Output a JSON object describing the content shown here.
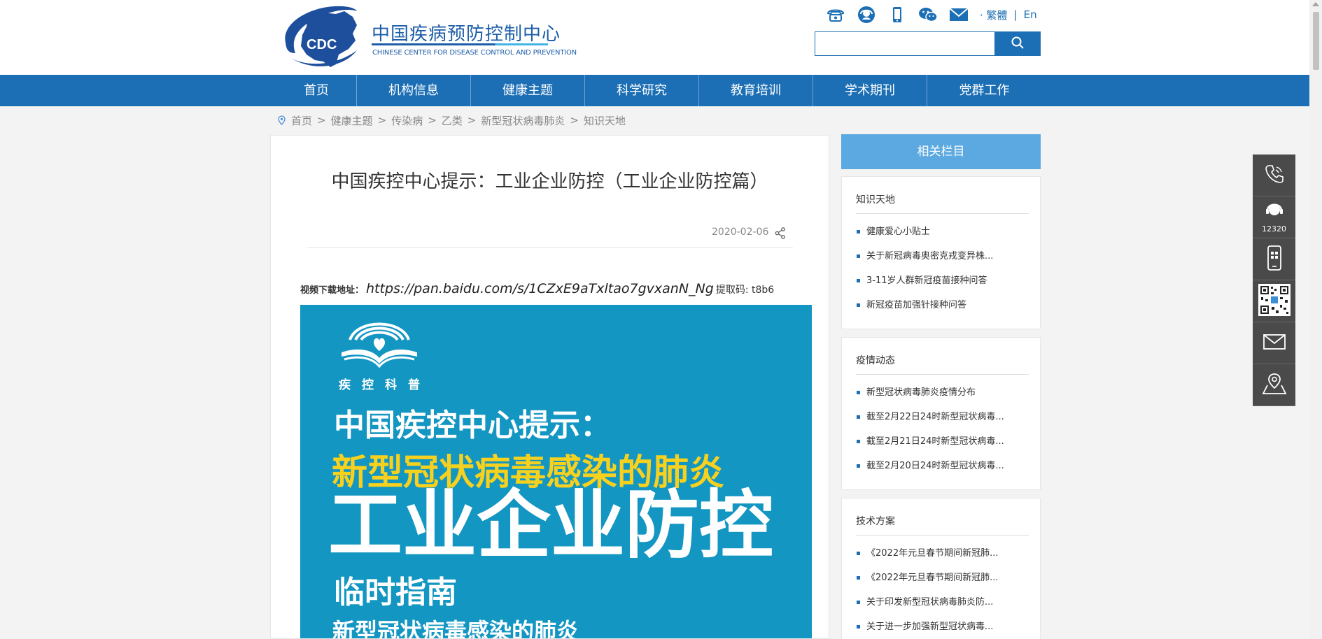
{
  "header": {
    "logo_text": "CDC",
    "site_name_cn": "中国疾病预防控制中心",
    "site_name_en": "CHINESE CENTER FOR DISEASE CONTROL AND PREVENTION",
    "top_icons": [
      "phone-icon",
      "hotline-icon",
      "mobile-icon",
      "wechat-icon",
      "mail-icon"
    ],
    "lang_traditional": "· 繁體",
    "lang_sep": "|",
    "lang_english": "En",
    "search_placeholder": ""
  },
  "nav": {
    "items": [
      {
        "label": "首页"
      },
      {
        "label": "机构信息"
      },
      {
        "label": "健康主题"
      },
      {
        "label": "科学研究"
      },
      {
        "label": "教育培训"
      },
      {
        "label": "学术期刊"
      },
      {
        "label": "党群工作"
      }
    ]
  },
  "breadcrumb": {
    "sep": ">",
    "items": [
      "首页",
      "健康主题",
      "传染病",
      "乙类",
      "新型冠状病毒肺炎",
      "知识天地"
    ]
  },
  "article": {
    "title": "中国疾控中心提示：工业企业防控（工业企业防控篇）",
    "date": "2020-02-06",
    "video_label": "视频下载地址：",
    "video_url": "https://pan.baidu.com/s/1CZxE9aTxltao7gvxanN_Ng",
    "extract_code": "提取码: t8b6",
    "poster": {
      "logo_text": "疾控科普",
      "line1": "中国疾控中心提示：",
      "line2": "新型冠状病毒感染的肺炎",
      "line3": "工业企业防控",
      "line4": "临时指南",
      "line5": "新型冠状病毒感染的肺炎"
    }
  },
  "sidebar": {
    "header": "相关栏目",
    "sections": [
      {
        "title": "知识天地",
        "items": [
          "健康爱心小贴士",
          "关于新冠病毒奥密克戎变异株...",
          "3-11岁人群新冠疫苗接种问答",
          "新冠疫苗加强针接种问答"
        ]
      },
      {
        "title": "疫情动态",
        "items": [
          "新型冠状病毒肺炎疫情分布",
          "截至2月22日24时新型冠状病毒...",
          "截至2月21日24时新型冠状病毒...",
          "截至2月20日24时新型冠状病毒..."
        ]
      },
      {
        "title": "技术方案",
        "items": [
          "《2022年元旦春节期间新冠肺...",
          "《2022年元旦春节期间新冠肺...",
          "关于印发新型冠状病毒肺炎防...",
          "关于进一步加强新型冠状病毒..."
        ]
      }
    ]
  },
  "float_bar": {
    "hotline_number": "12320",
    "items": [
      "phone-icon",
      "hotline-icon",
      "mobile-icon",
      "qrcode-icon",
      "mail-icon",
      "map-icon"
    ]
  },
  "colors": {
    "brand_blue": "#1d6fb5",
    "sidebar_header": "#5ba9e0",
    "poster_bg": "#1396c2",
    "poster_yellow": "#f7d11e",
    "float_bg": "#4a4a4a"
  }
}
